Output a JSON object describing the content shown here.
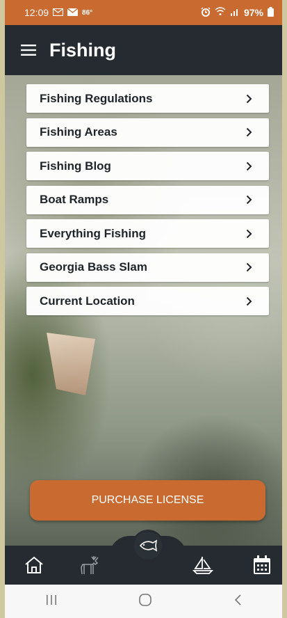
{
  "status_bar": {
    "time": "12:09",
    "temperature": "86°",
    "battery": "97%",
    "left_icons": [
      "gmail-icon",
      "mail-icon"
    ],
    "right_icons": [
      "alarm-icon",
      "wifi-icon",
      "signal-icon",
      "battery-icon"
    ]
  },
  "app_bar": {
    "title": "Fishing",
    "menu_icon": "hamburger-icon"
  },
  "menu": {
    "items": [
      {
        "label": "Fishing Regulations"
      },
      {
        "label": "Fishing Areas"
      },
      {
        "label": "Fishing Blog"
      },
      {
        "label": "Boat Ramps"
      },
      {
        "label": "Everything Fishing"
      },
      {
        "label": "Georgia Bass Slam"
      },
      {
        "label": "Current Location"
      }
    ]
  },
  "purchase_button": {
    "label": "PURCHASE LICENSE"
  },
  "bottom_nav": {
    "items": [
      "home-icon",
      "deer-icon",
      "fish-icon",
      "sailboat-icon",
      "calendar-icon"
    ]
  },
  "colors": {
    "accent": "#c96a30",
    "bar": "#252b30"
  }
}
